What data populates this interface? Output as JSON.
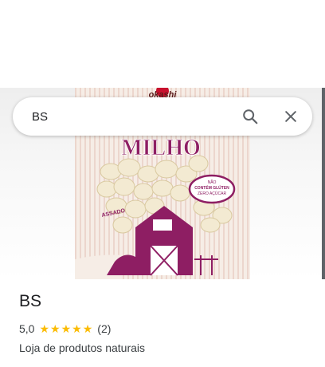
{
  "search": {
    "query": "BS"
  },
  "photo": {
    "brand": "okashi",
    "product_name": "MILHO",
    "badge_lines": [
      "NÃO",
      "CONTÉM GLÚTEN",
      "ZERO AÇÚCAR"
    ],
    "tag": "ASSADO"
  },
  "place": {
    "name": "BS",
    "rating": "5,0",
    "stars": 5,
    "review_count": "(2)",
    "category": "Loja de produtos naturais"
  },
  "colors": {
    "accent_purple": "#8e1e63",
    "star": "#fbbc04",
    "brand_red": "#c8102e"
  }
}
